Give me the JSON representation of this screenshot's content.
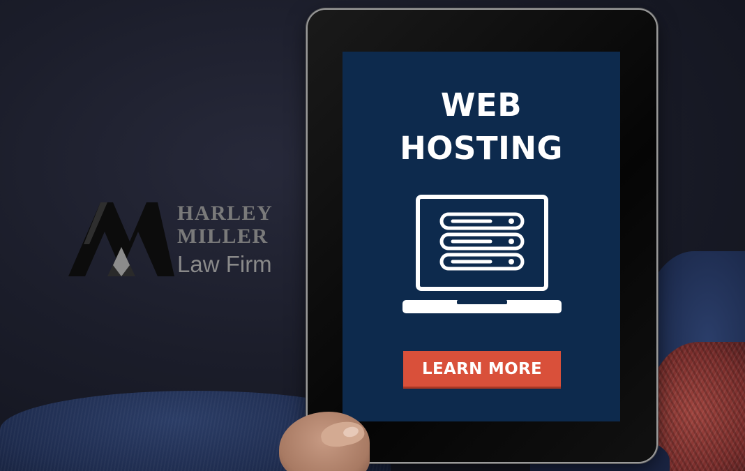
{
  "logo": {
    "line1": "HARLEY",
    "line2": "MILLER",
    "line3": "Law Firm",
    "color": "#7a7a7a"
  },
  "tablet_screen": {
    "heading_line1": "WEB",
    "heading_line2": "HOSTING",
    "icon": "server-laptop-icon",
    "cta_label": "LEARN MORE",
    "screen_color": "#0d2a4d",
    "cta_color": "#d9503a"
  }
}
